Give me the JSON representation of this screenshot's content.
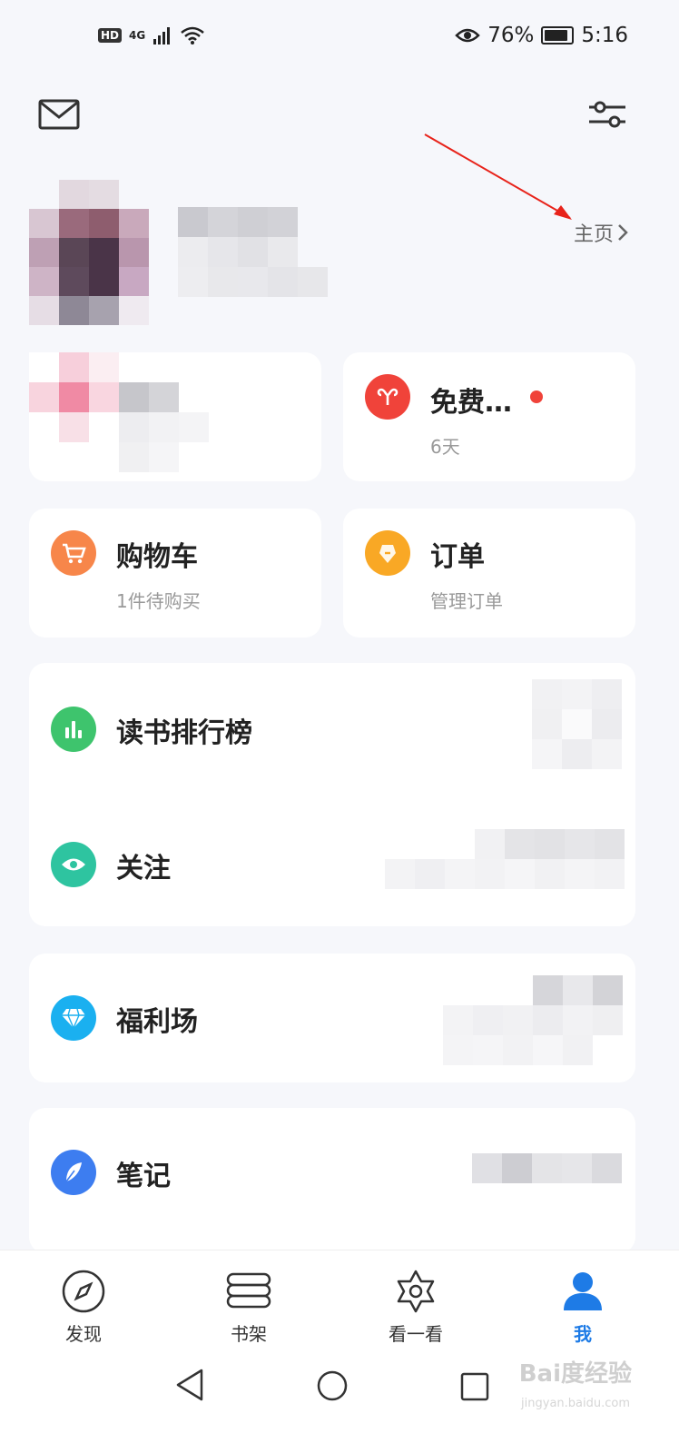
{
  "status_bar": {
    "hd": "HD",
    "network": "4G",
    "battery_text": "76%",
    "time": "5:16",
    "battery_level": 0.76
  },
  "header": {
    "mail_icon": "envelope-icon",
    "settings_icon": "sliders-icon"
  },
  "profile": {
    "homepage_link": "主页"
  },
  "cards": {
    "free": {
      "title": "免费…",
      "subtitle": "6天",
      "color": "#f0433a"
    },
    "cart": {
      "title": "购物车",
      "subtitle": "1件待购买",
      "color": "#f7864a"
    },
    "orders": {
      "title": "订单",
      "subtitle": "管理订单",
      "color": "#f9a825"
    }
  },
  "menu": {
    "ranking": {
      "label": "读书排行榜",
      "color": "#3ec46d"
    },
    "follow": {
      "label": "关注",
      "color": "#2ec4a0"
    },
    "welfare": {
      "label": "福利场",
      "color": "#1ab0f0"
    },
    "notes": {
      "label": "笔记",
      "color": "#3d7df0"
    }
  },
  "tabbar": {
    "items": [
      {
        "label": "发现",
        "icon": "compass-icon"
      },
      {
        "label": "书架",
        "icon": "bookshelf-icon"
      },
      {
        "label": "看一看",
        "icon": "star-icon"
      },
      {
        "label": "我",
        "icon": "person-icon"
      }
    ],
    "active_color": "#1e7be6"
  },
  "watermark": {
    "text": "Bai度经验",
    "sub": "jingyan.baidu.com"
  }
}
